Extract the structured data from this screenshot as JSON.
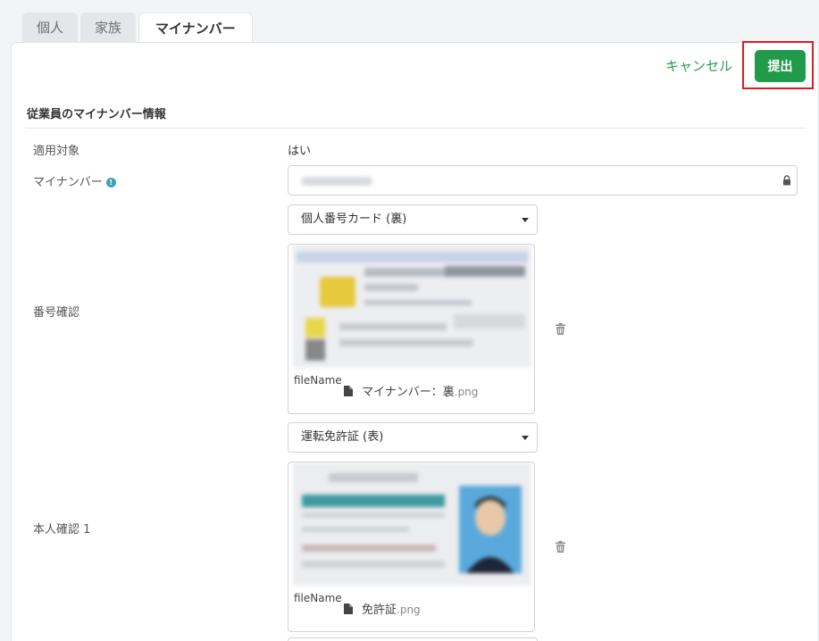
{
  "tabs": [
    {
      "label": "個人"
    },
    {
      "label": "家族"
    },
    {
      "label": "マイナンバー"
    }
  ],
  "actions": {
    "cancel": "キャンセル",
    "submit": "提出"
  },
  "section": {
    "title": "従業員のマイナンバー情報"
  },
  "fields": {
    "applicable": {
      "label": "適用対象",
      "value": "はい"
    },
    "mynumber": {
      "label": "マイナンバー"
    },
    "number_check": {
      "label": "番号確認",
      "document_type": "個人番号カード (裏)",
      "file_label": "fileName",
      "file_name": "マイナンバー：裏",
      "file_ext": ".png"
    },
    "identity_check_1": {
      "label": "本人確認 1",
      "document_type": "運転免許証 (表)",
      "file_label": "fileName",
      "file_name": "免許証",
      "file_ext": ".png"
    }
  },
  "colors": {
    "accent": "#219a4a",
    "highlight": "#e0191e",
    "link": "#2e9b4f"
  }
}
